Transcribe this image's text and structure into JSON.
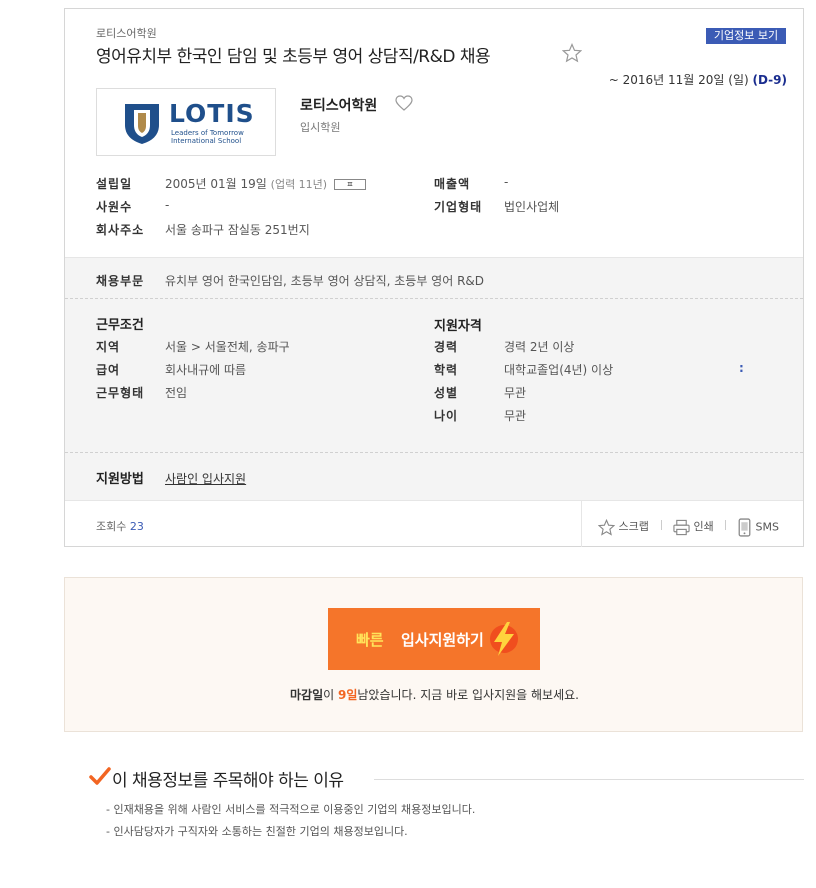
{
  "header": {
    "company_small": "로티스어학원",
    "title": "영어유치부 한국인 담임 및 초등부 영어 상담직/R&D 채용",
    "corp_info_button": "기업정보 보기",
    "deadline_prefix": "~ 2016년 11월 20일 (일)",
    "dday": "(D-9)"
  },
  "company": {
    "logo_text": "LOTIS",
    "logo_sub1": "Leaders of Tomorrow",
    "logo_sub2": "International School",
    "name": "로티스어학원",
    "type": "입시학원",
    "info": {
      "founded_label": "설립일",
      "founded_value": "2005년 01월 19일",
      "founded_years": "(업력 11년)",
      "founded_btn": "ㅍ",
      "employees_label": "사원수",
      "employees_value": "-",
      "address_label": "회사주소",
      "address_value": "서울 송파구 잠실동 251번지",
      "revenue_label": "매출액",
      "revenue_value": "-",
      "corp_type_label": "기업형태",
      "corp_type_value": "법인사업체"
    }
  },
  "recruit": {
    "dept_label": "채용부문",
    "dept_value": "유치부 영어 한국인담임, 초등부 영어 상담직, 초등부 영어 R&D",
    "conditions_head": "근무조건",
    "region_label": "지역",
    "region_value": "서울 > 서울전체, 송파구",
    "salary_label": "급여",
    "salary_value": "회사내규에 따름",
    "worktype_label": "근무형태",
    "worktype_value": "전임",
    "qual_head": "지원자격",
    "career_label": "경력",
    "career_value": "경력 2년 이상",
    "edu_label": "학력",
    "edu_value": "대학교졸업(4년) 이상",
    "edu_mark": ":",
    "gender_label": "성별",
    "gender_value": "무관",
    "age_label": "나이",
    "age_value": "무관",
    "method_label": "지원방법",
    "method_value": "사람인 입사지원"
  },
  "footer": {
    "views_label": "조회수",
    "views_count": "23",
    "scrap": "스크랩",
    "print": "인쇄",
    "sms": "SMS"
  },
  "apply": {
    "btn_part1": "빠른",
    "btn_part2": "입사지원하기",
    "remain_a": "마감일",
    "remain_b": "이 ",
    "remain_days": "9일",
    "remain_c": "남았습니다. 지금 바로 입사지원을 해보세요."
  },
  "reason": {
    "title": "이 채용정보를 주목해야 하는 이유",
    "items": [
      "- 인재채용을 위해 사람인 서비스를 적극적으로 이용중인 기업의 채용정보입니다.",
      "- 인사담당자가 구직자와 소통하는 친절한 기업의 채용정보입니다."
    ]
  },
  "colors": {
    "accent_blue": "#3b5bb5",
    "dday_navy": "#1a2d8f",
    "apply_orange": "#f5752a",
    "check_orange": "#f26522"
  }
}
